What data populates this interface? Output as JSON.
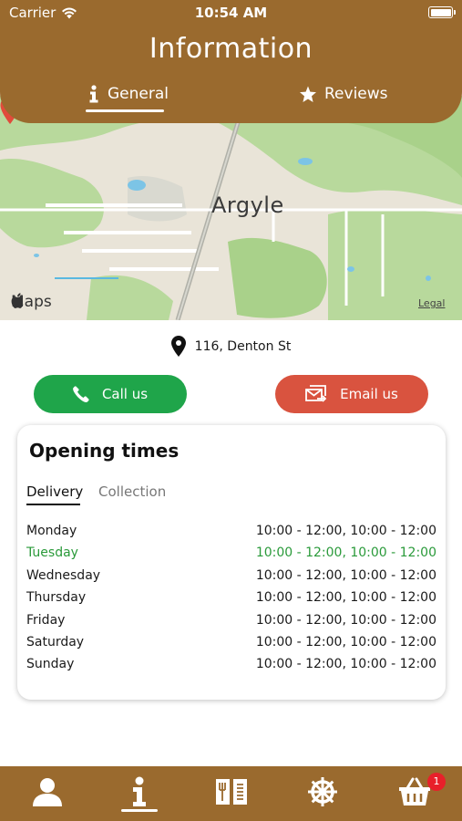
{
  "status_bar": {
    "carrier": "Carrier",
    "time": "10:54 AM"
  },
  "header": {
    "title": "Information",
    "tabs": [
      {
        "label": "General",
        "icon": "info-icon",
        "active": true
      },
      {
        "label": "Reviews",
        "icon": "star-icon",
        "active": false
      }
    ]
  },
  "map": {
    "town_label": "Argyle",
    "brand": "Maps",
    "legal": "Legal"
  },
  "location": {
    "address": "116, Denton St"
  },
  "actions": {
    "call_label": "Call us",
    "email_label": "Email us"
  },
  "opening_times": {
    "title": "Opening times",
    "tabs": [
      {
        "label": "Delivery",
        "active": true
      },
      {
        "label": "Collection",
        "active": false
      }
    ],
    "rows": [
      {
        "day": "Monday",
        "hours": "10:00 - 12:00, 10:00 - 12:00",
        "today": false
      },
      {
        "day": "Tuesday",
        "hours": "10:00 - 12:00, 10:00 - 12:00",
        "today": true
      },
      {
        "day": "Wednesday",
        "hours": "10:00 - 12:00, 10:00 - 12:00",
        "today": false
      },
      {
        "day": "Thursday",
        "hours": "10:00 - 12:00, 10:00 - 12:00",
        "today": false
      },
      {
        "day": "Friday",
        "hours": "10:00 - 12:00, 10:00 - 12:00",
        "today": false
      },
      {
        "day": "Saturday",
        "hours": "10:00 - 12:00, 10:00 - 12:00",
        "today": false
      },
      {
        "day": "Sunday",
        "hours": "10:00 - 12:00, 10:00 - 12:00",
        "today": false
      }
    ]
  },
  "tab_bar": {
    "items": [
      {
        "icon": "profile-icon",
        "active": false
      },
      {
        "icon": "info-icon",
        "active": true
      },
      {
        "icon": "menu-book-icon",
        "active": false
      },
      {
        "icon": "settings-wheel-icon",
        "active": false
      },
      {
        "icon": "basket-icon",
        "active": false
      }
    ],
    "basket_badge": "1"
  },
  "colors": {
    "brand": "#9a6a2e",
    "call": "#1fa54a",
    "email": "#d9533f",
    "today": "#2a9a3a",
    "badge": "#e8202a"
  }
}
